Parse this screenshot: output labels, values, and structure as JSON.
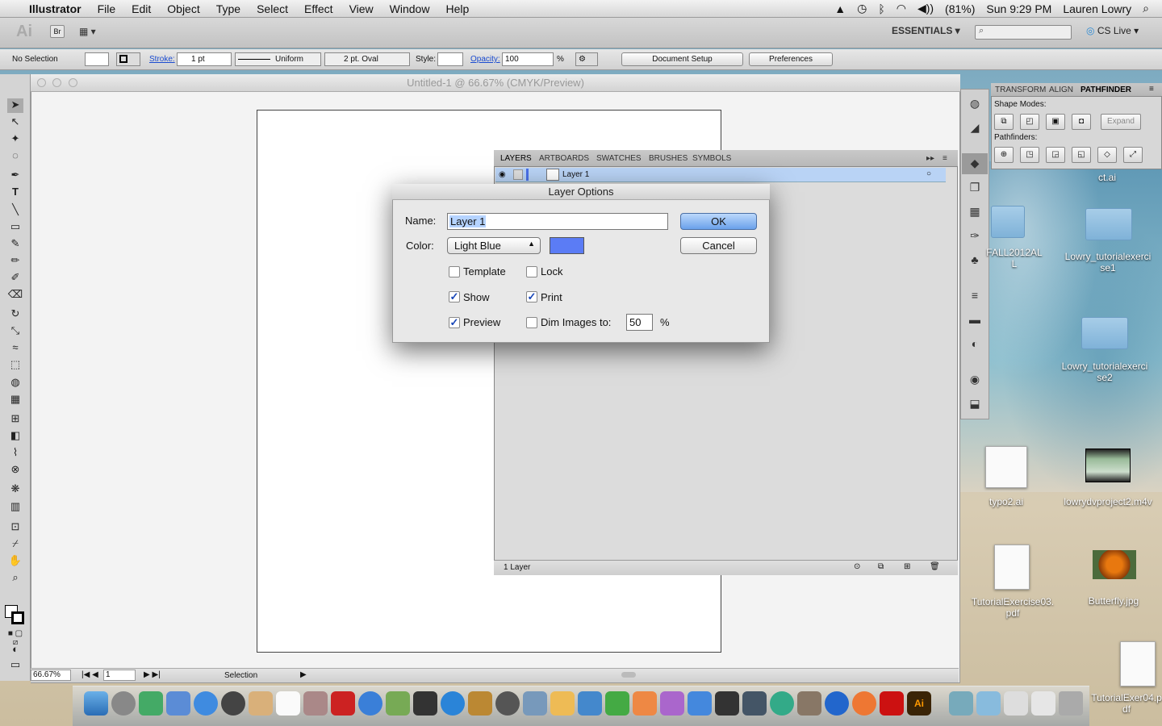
{
  "menubar": {
    "app": "Illustrator",
    "items": [
      "File",
      "Edit",
      "Object",
      "Type",
      "Select",
      "Effect",
      "View",
      "Window",
      "Help"
    ],
    "battery": "(81%)",
    "clock": "Sun 9:29 PM",
    "user": "Lauren Lowry"
  },
  "apptoolbar": {
    "logo": "Ai",
    "bridge": "Br",
    "workspace": "ESSENTIALS ▾",
    "cslive": "CS Live ▾"
  },
  "controlbar": {
    "selection": "No Selection",
    "stroke_label": "Stroke:",
    "stroke_value": "1 pt",
    "profile": "Uniform",
    "brush": "2 pt. Oval",
    "style_label": "Style:",
    "opacity_label": "Opacity:",
    "opacity_value": "100",
    "percent": "%",
    "document_setup": "Document Setup",
    "preferences": "Preferences"
  },
  "document": {
    "title": "Untitled-1 @ 66.67% (CMYK/Preview)",
    "zoom": "66.67%",
    "page": "1",
    "status": "Selection"
  },
  "layers_panel": {
    "tabs": [
      "LAYERS",
      "ARTBOARDS",
      "SWATCHES",
      "BRUSHES",
      "SYMBOLS"
    ],
    "layer_name": "Layer 1",
    "footer": "1 Layer"
  },
  "pathfinder_panel": {
    "tabs": [
      "TRANSFORM",
      "ALIGN",
      "PATHFINDER"
    ],
    "shape_modes": "Shape Modes:",
    "pathfinders": "Pathfinders:",
    "expand": "Expand"
  },
  "dialog": {
    "title": "Layer Options",
    "name_label": "Name:",
    "name_value": "Layer 1",
    "color_label": "Color:",
    "color_value": "Light Blue",
    "swatch": "#5b7cf5",
    "template": "Template",
    "lock": "Lock",
    "show": "Show",
    "print": "Print",
    "preview": "Preview",
    "dim": "Dim Images to:",
    "dim_value": "50",
    "pct": "%",
    "ok": "OK",
    "cancel": "Cancel",
    "checks": {
      "template": false,
      "lock": false,
      "show": true,
      "print": true,
      "preview": true,
      "dim": false
    }
  },
  "desktop": {
    "icons": [
      "ct.ai",
      "FALL2012ALL",
      "Lowry_tutorialexercise1",
      "Lowry_tutorialexercise2",
      "typo2.ai",
      "lowrydvproject2.m4v",
      "TutorialExercise03.pdf",
      "Butterfly.jpg",
      "TutorialExer04.pdf"
    ]
  }
}
